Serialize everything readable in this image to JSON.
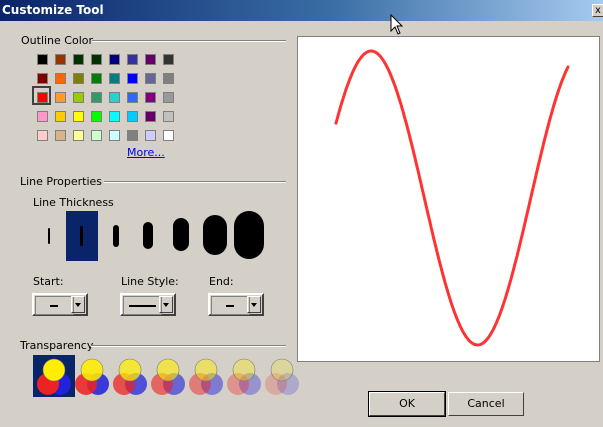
{
  "window": {
    "title": "Customize Tool",
    "close_glyph": "x"
  },
  "outline_color": {
    "label": "Outline Color",
    "selected": "#ff0000",
    "more_label": "More...",
    "rows": [
      [
        "#000000",
        "#993300",
        "#003300",
        "#003300",
        "#000080",
        "#333399",
        "#660066",
        "#333333"
      ],
      [
        "#800000",
        "#ff6600",
        "#808000",
        "#008000",
        "#008080",
        "#0000ff",
        "#666699",
        "#808080"
      ],
      [
        "#ff0000",
        "#ff9933",
        "#99cc00",
        "#339966",
        "#33cccc",
        "#3366ff",
        "#800080",
        "#999999"
      ],
      [
        "#ff99cc",
        "#ffcc00",
        "#ffff00",
        "#00ff00",
        "#00ffff",
        "#00ccff",
        "#660066",
        "#c0c0c0"
      ],
      [
        "#ffcccc",
        "#d9b38c",
        "#ffff99",
        "#ccffcc",
        "#ccffff",
        "#808080",
        "#ccccff",
        "#ffffff"
      ]
    ]
  },
  "line_properties": {
    "label": "Line Properties",
    "thickness_label": "Line Thickness",
    "selected_thickness": 2,
    "thickness_count": 7,
    "start_label": "Start:",
    "style_label": "Line Style:",
    "end_label": "End:"
  },
  "transparency": {
    "label": "Transparency",
    "selected": 1,
    "count": 7
  },
  "buttons": {
    "ok": "OK",
    "cancel": "Cancel"
  },
  "preview": {
    "stroke_color": "#ff3333"
  }
}
